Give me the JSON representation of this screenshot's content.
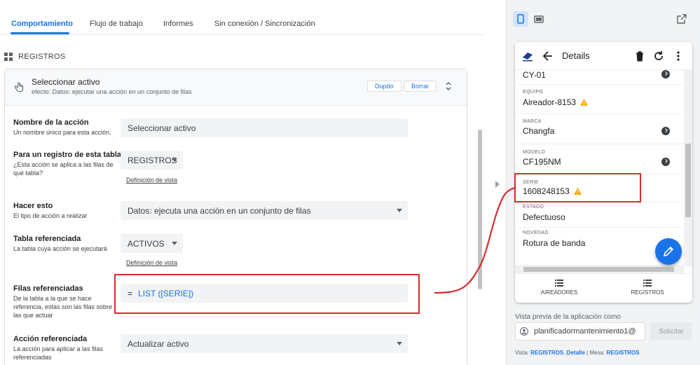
{
  "tabs": [
    "Comportamiento",
    "Flujo de trabajo",
    "Informes",
    "Sin conexión / Sincronización"
  ],
  "section_title": "REGISTROS",
  "action": {
    "title": "Seleccionar activo",
    "effect": "efecto: Datos: ejecutar una acción en un conjunto de filas",
    "duplicate_label": "Dupdo",
    "delete_label": "Borrar"
  },
  "form": {
    "name_label": "Nombre de la acción",
    "name_help": "Un nombre único para esta acción.",
    "name_value": "Seleccionar activo",
    "table_label": "Para un registro de esta tabla",
    "table_help": "¿Esta acción se aplica a las filas de qué tabla?",
    "table_value": "REGISTROS",
    "view_def_link": "Definición de vista",
    "do_label": "Hacer esto",
    "do_help": "El tipo de acción a realizar",
    "do_value": "Datos: ejecuta una acción en un conjunto de filas",
    "ref_table_label": "Tabla referenciada",
    "ref_table_help": "La tabla cuya acción se ejecutará",
    "ref_table_value": "ACTIVOS",
    "ref_rows_label": "Filas referenciadas",
    "ref_rows_help": "De la tabla a la que se hace referencia, estas son las filas sobre las que actuar",
    "ref_rows_eq": "=",
    "ref_rows_value": "LIST ([SERIE])",
    "ref_action_label": "Acción referenciada",
    "ref_action_help": "La acción para aplicar a las filas referenciadas",
    "ref_action_value": "Actualizar activo"
  },
  "preview": {
    "header_title": "Details",
    "fields": [
      {
        "label": "",
        "value": "CY-01"
      },
      {
        "label": "EQUIPO",
        "value": "Aireador-8153"
      },
      {
        "label": "MARCA",
        "value": "Changfa"
      },
      {
        "label": "MODELO",
        "value": "CF195NM"
      },
      {
        "label": "SERIE",
        "value": "1608248153"
      },
      {
        "label": "ESTADO",
        "value": "Defectuoso"
      },
      {
        "label": "NOVEDAD",
        "value": "Rotura de banda"
      }
    ],
    "nav": [
      "AIREADORES",
      "REGISTROS"
    ],
    "preview_as_label": "Vista previa de la aplicación como",
    "email": "planificadormantenimiento1@",
    "request_button": "Solicitar",
    "footer_view_label": "Vista:",
    "footer_view": "REGISTROS_Detalle",
    "footer_sep": "|",
    "footer_table_label": "Mesa:",
    "footer_table": "REGISTROS"
  },
  "colors": {
    "accent": "#1a73e8",
    "annotation": "#d32f2f",
    "warning": "#f9ab00"
  }
}
